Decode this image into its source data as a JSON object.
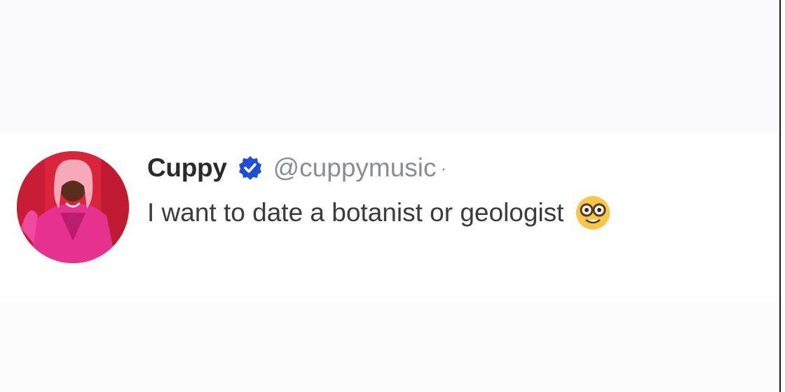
{
  "tweet": {
    "display_name": "Cuppy",
    "handle": "@cuppymusic",
    "separator": "·",
    "text": "I want to date a botanist or geologist"
  },
  "icons": {
    "verified": "verified-badge-icon",
    "emoji": "nerd-face-emoji-icon",
    "avatar": "profile-avatar"
  },
  "colors": {
    "verified_badge": "#1d4ed8",
    "avatar_background": "#d9243c",
    "outfit": "#e6318f",
    "hair": "#f6a9b8",
    "emoji_face": "#f7c64a"
  }
}
